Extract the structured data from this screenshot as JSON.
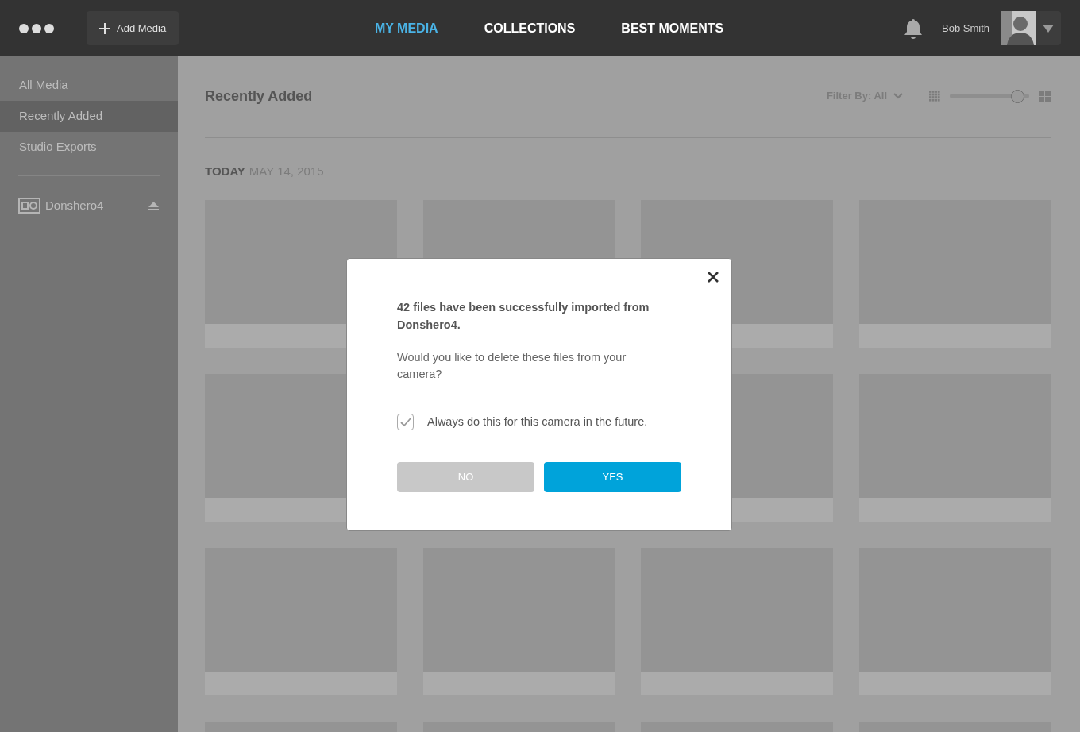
{
  "topbar": {
    "add_button": "Add Media",
    "nav": [
      {
        "label": "MY MEDIA",
        "selected": true
      },
      {
        "label": "COLLECTIONS",
        "selected": false
      },
      {
        "label": "BEST MOMENTS",
        "selected": false
      }
    ],
    "user_name": "Bob Smith"
  },
  "sidebar": {
    "items": [
      {
        "label": "All Media",
        "selected": false
      },
      {
        "label": "Recently Added",
        "selected": true
      },
      {
        "label": "Studio Exports",
        "selected": false
      }
    ],
    "device": "Donshero4"
  },
  "main": {
    "title": "Recently Added",
    "filter": "Filter By: All",
    "zoom": {
      "level": 0.85
    },
    "date_heading": {
      "day": "TODAY",
      "date": "MAY 14, 2015"
    },
    "thumbnails": [
      {
        "kind": "placeholder"
      },
      {
        "kind": "placeholder"
      },
      {
        "kind": "placeholder"
      },
      {
        "kind": "placeholder"
      },
      {
        "kind": "placeholder"
      },
      {
        "kind": "covered"
      },
      {
        "kind": "placeholder"
      },
      {
        "kind": "placeholder"
      },
      {
        "kind": "placeholder"
      },
      {
        "kind": "placeholder"
      },
      {
        "kind": "placeholder"
      },
      {
        "kind": "placeholder"
      },
      {
        "kind": "placeholder"
      },
      {
        "kind": "placeholder"
      },
      {
        "kind": "placeholder"
      },
      {
        "kind": "placeholder"
      }
    ]
  },
  "dialog": {
    "message": "42 files have been successfully imported from Donshero4.",
    "question": "Would you like to delete these files from your camera?",
    "checkbox": {
      "label": "Always do this for this camera in the future.",
      "checked": true
    },
    "buttons": [
      {
        "label": "NO",
        "kind": "secondary"
      },
      {
        "label": "YES",
        "kind": "primary"
      }
    ]
  }
}
